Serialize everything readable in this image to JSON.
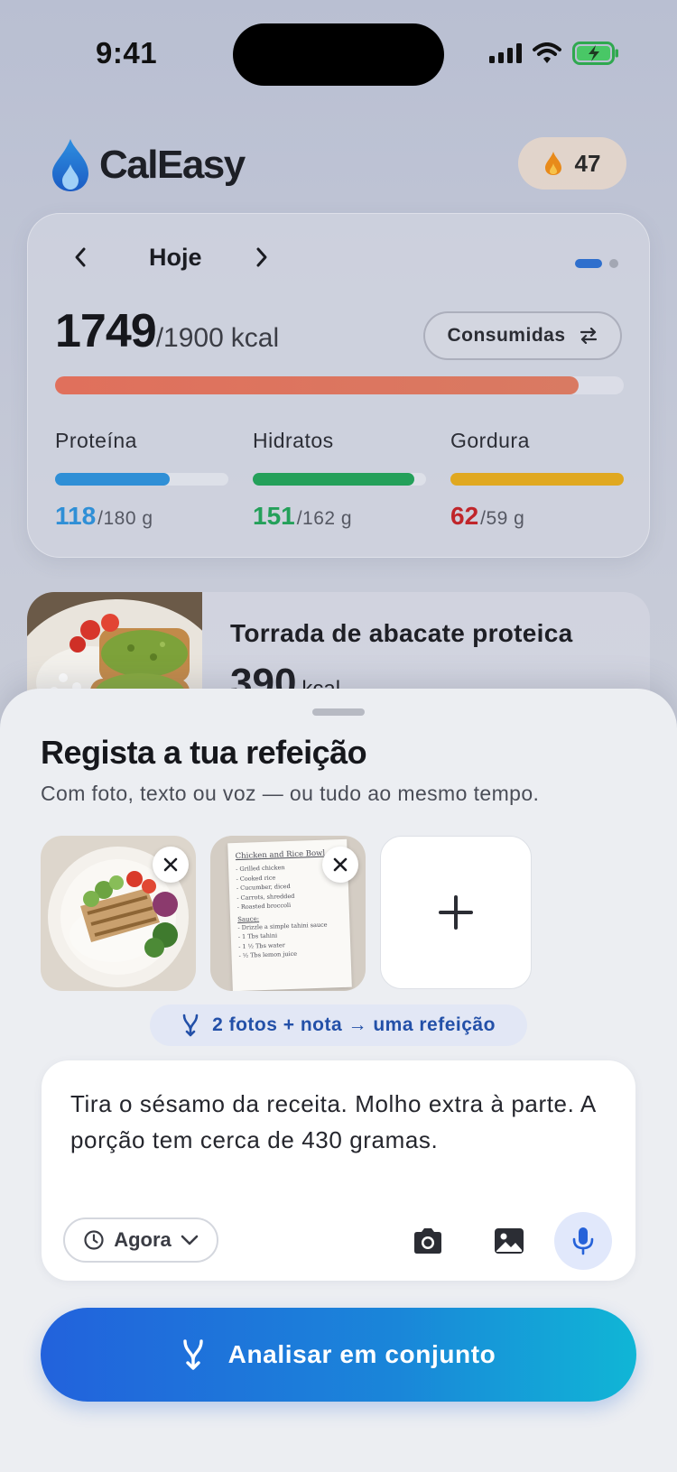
{
  "status_bar": {
    "time": "9:41"
  },
  "header": {
    "brand": "CalEasy",
    "streak_count": "47"
  },
  "summary": {
    "day_label": "Hoje",
    "kcal_consumed": "1749",
    "kcal_goal": "/1900",
    "kcal_unit": "kcal",
    "calorie_progress": 0.92,
    "toggle_label": "Consumidas",
    "macros": [
      {
        "name": "Proteína",
        "value": "118",
        "goal": "/180 g",
        "progress": 0.66,
        "color": "#2f8fd6"
      },
      {
        "name": "Hidratos",
        "value": "151",
        "goal": "/162 g",
        "progress": 0.93,
        "color": "#24a05a"
      },
      {
        "name": "Gordura",
        "value": "62",
        "goal": "/59 g",
        "progress": 1.0,
        "color": "#e0a820",
        "value_color": "#c0252a"
      }
    ]
  },
  "meal": {
    "title": "Torrada de abacate proteica",
    "kcal": "390",
    "kcal_unit": "kcal"
  },
  "sheet": {
    "title": "Regista a tua refeição",
    "subtitle": "Com foto, texto ou voz — ou tudo ao mesmo tempo.",
    "recipe_card": {
      "heading": "Chicken and Rice Bowl",
      "lines": [
        "- Grilled chicken",
        "- Cooked rice",
        "- Cucumber, diced",
        "- Carrots, shredded",
        "- Roasted broccoli"
      ],
      "sauce_heading": "Sauce:",
      "sauce_lines": [
        "- Drizzle a simple tahini sauce",
        "- 1 Tbs tahini",
        "- 1 ½ Tbs water",
        "- ½ Tbs lemon juice"
      ]
    },
    "combine_chip": "2 fotos + nota → uma refeição",
    "note_text": "Tira o sésamo da receita. Molho extra à parte. A porção tem cerca de 430 gramas.",
    "time_pill": "Agora",
    "cta_label": "Analisar em conjunto"
  }
}
